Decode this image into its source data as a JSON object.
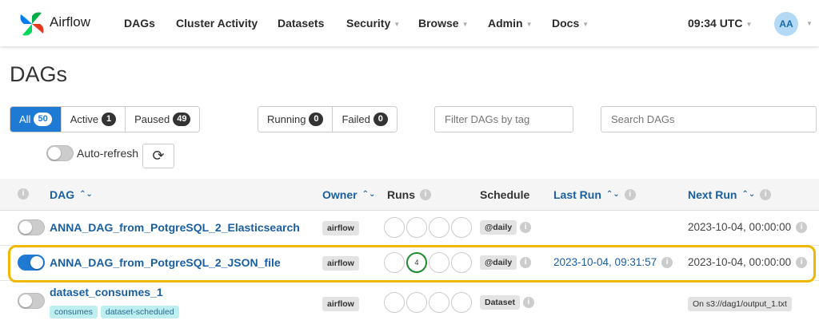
{
  "navbar": {
    "brand": "Airflow",
    "items": [
      {
        "label": "DAGs",
        "dropdown": false
      },
      {
        "label": "Cluster Activity",
        "dropdown": false
      },
      {
        "label": "Datasets",
        "dropdown": false
      },
      {
        "label": "Security",
        "dropdown": true
      },
      {
        "label": "Browse",
        "dropdown": true
      },
      {
        "label": "Admin",
        "dropdown": true
      },
      {
        "label": "Docs",
        "dropdown": true
      }
    ],
    "time": "09:34 UTC",
    "avatar_initials": "AA"
  },
  "page": {
    "title": "DAGs"
  },
  "status_filter": {
    "all": {
      "label": "All",
      "count": "50"
    },
    "active": {
      "label": "Active",
      "count": "1"
    },
    "paused": {
      "label": "Paused",
      "count": "49"
    }
  },
  "run_filter": {
    "running": {
      "label": "Running",
      "count": "0"
    },
    "failed": {
      "label": "Failed",
      "count": "0"
    }
  },
  "tag_filter": {
    "placeholder": "Filter DAGs by tag"
  },
  "search": {
    "placeholder": "Search DAGs"
  },
  "autorefresh": {
    "label": "Auto-refresh"
  },
  "table": {
    "headers": {
      "dag": "DAG",
      "owner": "Owner",
      "runs": "Runs",
      "schedule": "Schedule",
      "last_run": "Last Run",
      "next_run": "Next Run"
    },
    "rows": [
      {
        "dag_id": "ANNA_DAG_from_PotgreSQL_2_Elasticsearch",
        "active": false,
        "tags": [],
        "owner": "airflow",
        "runs": [
          "",
          "",
          "",
          ""
        ],
        "schedule": "@daily",
        "last_run": "",
        "next_run": "2023-10-04, 00:00:00"
      },
      {
        "dag_id": "ANNA_DAG_from_PotgreSQL_2_JSON_file",
        "active": true,
        "tags": [],
        "owner": "airflow",
        "runs": [
          "",
          "4",
          "",
          ""
        ],
        "schedule": "@daily",
        "last_run": "2023-10-04, 09:31:57",
        "next_run": "2023-10-04, 00:00:00"
      },
      {
        "dag_id": "dataset_consumes_1",
        "active": false,
        "tags": [
          "consumes",
          "dataset-scheduled"
        ],
        "owner": "airflow",
        "runs": [
          "",
          "",
          "",
          ""
        ],
        "schedule": "Dataset",
        "last_run": "",
        "next_run": "On s3://dag1/output_1.txt"
      }
    ]
  },
  "colors": {
    "accent": "#1f7ad4",
    "link": "#1a5fa0",
    "highlight": "#f0b800",
    "success": "#1e8a2e"
  }
}
